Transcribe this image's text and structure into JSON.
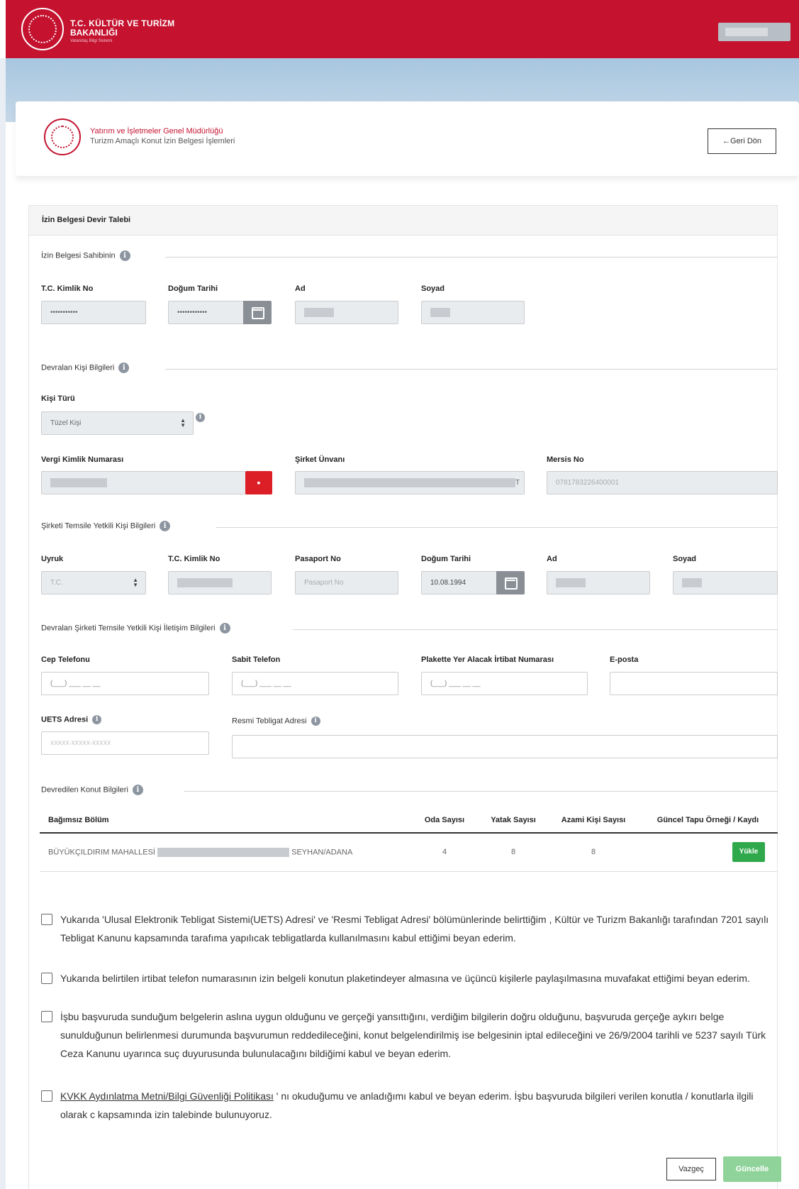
{
  "header": {
    "ministry_line1": "T.C. KÜLTÜR VE TURİZM",
    "ministry_line2": "BAKANLIĞI",
    "ministry_tagline": "Vatandaş Bilgi Sistemi"
  },
  "org": {
    "title": "Yatırım ve İşletmeler Genel Müdürlüğü",
    "subtitle": "Turizm Amaçlı Konut İzin Belgesi İşlemleri",
    "back_label": "←Geri Dön"
  },
  "form": {
    "title": "İzin Belgesi Devir Talebi"
  },
  "owner": {
    "section_title": "İzin Belgesi Sahibinin",
    "tc_label": "T.C. Kimlik No",
    "tc_value": "•••••••••••",
    "dob_label": "Doğum Tarihi",
    "dob_value": "••••••••••••",
    "name_label": "Ad",
    "surname_label": "Soyad"
  },
  "transferee": {
    "section_title": "Devralan Kişi Bilgileri",
    "person_type_label": "Kişi Türü",
    "person_type_value": "Tüzel Kişi",
    "tax_label": "Vergi Kimlik Numarası",
    "company_label": "Şirket Ünvanı",
    "company_suffix": "T",
    "mersis_label": "Mersis No",
    "mersis_value": "0781783226400001"
  },
  "representative": {
    "section_title": "Şirketi Temsile Yetkili Kişi Bilgileri",
    "nationality_label": "Uyruk",
    "nationality_value": "T.C.",
    "tc_label": "T.C. Kimlik No",
    "passport_label": "Pasaport No",
    "passport_placeholder": "Pasaport No",
    "dob_label": "Doğum Tarihi",
    "dob_value": "10.08.1994",
    "name_label": "Ad",
    "surname_label": "Soyad"
  },
  "contact": {
    "section_title": "Devralan Şirketi Temsile Yetkili Kişi İletişim Bilgileri",
    "mobile_label": "Cep Telefonu",
    "mobile_placeholder": "(___) ___ __ __",
    "landline_label": "Sabit Telefon",
    "landline_placeholder": "(___) ___ __ __",
    "plaque_label": "Plakette Yer Alacak İrtibat Numarası",
    "plaque_placeholder": "(___) ___ __ __",
    "email_label": "E-posta",
    "uets_label": "UETS Adresi",
    "uets_placeholder": "XXXXX-XXXXX-XXXXX",
    "official_label": "Resmi Tebligat Adresi"
  },
  "property": {
    "section_title": "Devredilen Konut Bilgileri",
    "columns": [
      "Bağımsız Bölüm",
      "Oda Sayısı",
      "Yatak Sayısı",
      "Azami Kişi Sayısı",
      "Güncel Tapu Örneği / Kaydı"
    ],
    "row": {
      "address_start": "BÜYÜKÇILDIRIM MAHALLESİ",
      "address_end": "SEYHAN/ADANA",
      "rooms": "4",
      "beds": "8",
      "max_people": "8",
      "upload_label": "Yükle"
    }
  },
  "declarations": {
    "d1": "Yukarıda 'Ulusal Elektronik Tebligat Sistemi(UETS) Adresi' ve 'Resmi Tebligat Adresi' bölümünlerinde belirttiğim , Kültür ve Turizm Bakanlığı tarafından 7201 sayılı Tebligat Kanunu kapsamında tarafıma yapılıcak tebligatlarda kullanılmasını kabul ettiğimi beyan ederim.",
    "d2": "Yukarıda belirtilen irtibat telefon numarasının izin belgeli konutun plaketindeyer almasına ve üçüncü kişilerle paylaşılmasına muvafakat ettiğimi beyan ederim.",
    "d3": "İşbu başvuruda sunduğum belgelerin aslına uygun olduğunu ve gerçeği yansıttığını, verdiğim bilgilerin doğru olduğunu, başvuruda gerçeğe aykırı belge sunulduğunun belirlenmesi durumunda başvurumun reddedileceğini, konut belgelendirilmiş ise belgesinin iptal edileceğini ve 26/9/2004 tarihli ve 5237 sayılı Türk Ceza Kanunu uyarınca suç duyurusunda bulunulacağını bildiğimi kabul ve beyan ederim.",
    "d4_link": "KVKK Aydınlatma Metni/Bilgi Güvenliği Politikası",
    "d4_rest": " ' nı okuduğumu ve anladığımı kabul ve beyan ederim. İşbu başvuruda bilgileri verilen konutla / konutlarla ilgili olarak c kapsamında izin talebinde bulunuyoruz."
  },
  "actions": {
    "cancel": "Vazgeç",
    "update": "Güncelle"
  }
}
